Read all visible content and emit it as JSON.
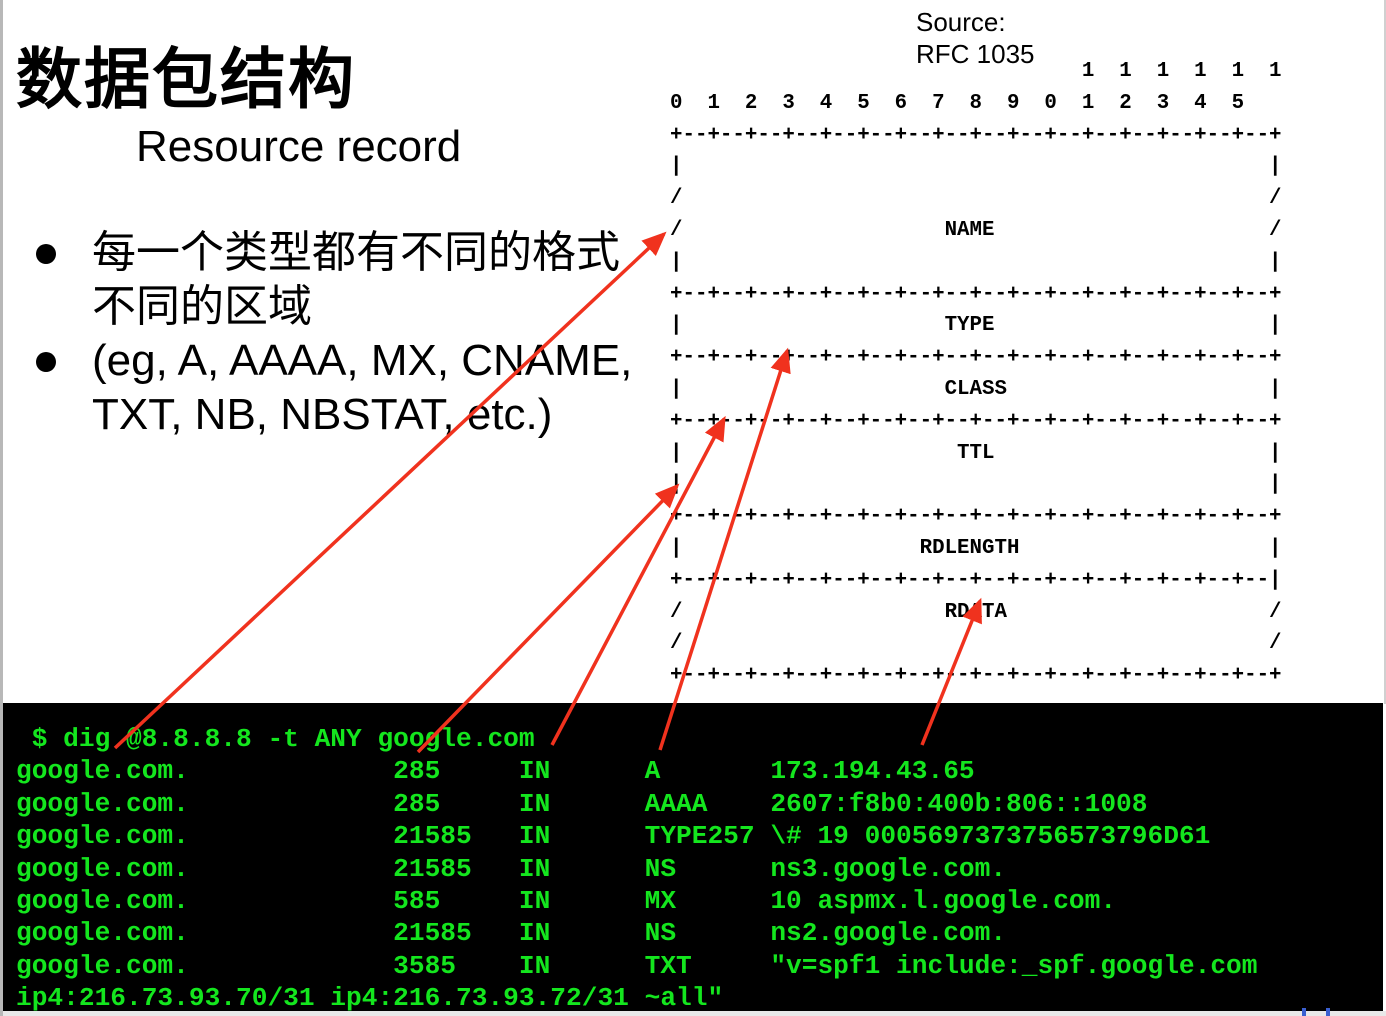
{
  "slide": {
    "title": "数据包结构",
    "subtitle": "Resource record",
    "bullets": [
      {
        "line1": "每一个类型都有不同的格式",
        "line2": "不同的区域"
      },
      {
        "line1": "(eg, A, AAAA, MX, CNAME,",
        "line2": "TXT, NB, NBSTAT, etc.)"
      }
    ],
    "source_label": "Source:",
    "source_ref": "RFC 1035"
  },
  "rr_format": {
    "bit_header_tens": "                                    1  1  1  1  1  1",
    "bit_header_units": "      0  1  2  3  4  5  6  7  8  9  0  1  2  3  4  5",
    "separator": "+--+--+--+--+--+--+--+--+--+--+--+--+--+--+--+--+",
    "rdlength_separator": "+--+--+--+--+--+--+--+--+--+--+--+--+--+--+--+--|",
    "fields": [
      "NAME",
      "TYPE",
      "CLASS",
      "TTL",
      "RDLENGTH",
      "RDATA"
    ]
  },
  "terminal": {
    "command": " $ dig @8.8.8.8 -t ANY google.com",
    "records": [
      {
        "name": "google.com.",
        "ttl": "285",
        "class": "IN",
        "type": "A",
        "data": "173.194.43.65"
      },
      {
        "name": "google.com.",
        "ttl": "285",
        "class": "IN",
        "type": "AAAA",
        "data": "2607:f8b0:400b:806::1008"
      },
      {
        "name": "google.com.",
        "ttl": "21585",
        "class": "IN",
        "type": "TYPE257",
        "data": "\\# 19 0005697373756573796D61"
      },
      {
        "name": "google.com.",
        "ttl": "21585",
        "class": "IN",
        "type": "NS",
        "data": "ns3.google.com."
      },
      {
        "name": "google.com.",
        "ttl": "585",
        "class": "IN",
        "type": "MX",
        "data": "10 aspmx.l.google.com."
      },
      {
        "name": "google.com.",
        "ttl": "21585",
        "class": "IN",
        "type": "NS",
        "data": "ns2.google.com."
      },
      {
        "name": "google.com.",
        "ttl": "3585",
        "class": "IN",
        "type": "TXT",
        "data": "\"v=spf1 include:_spf.google.com"
      }
    ],
    "continuation": "ip4:216.73.93.70/31 ip4:216.73.93.72/31 ~all\""
  },
  "annotations": {
    "arrow_color": "#f0321e",
    "terminal_text_color": "#14e61e",
    "arrows": [
      {
        "from": "record-name",
        "to": "NAME"
      },
      {
        "from": "record-ttl",
        "to": "TTL"
      },
      {
        "from": "record-class",
        "to": "CLASS"
      },
      {
        "from": "record-type",
        "to": "TYPE"
      },
      {
        "from": "record-data",
        "to": "RDATA"
      }
    ]
  }
}
